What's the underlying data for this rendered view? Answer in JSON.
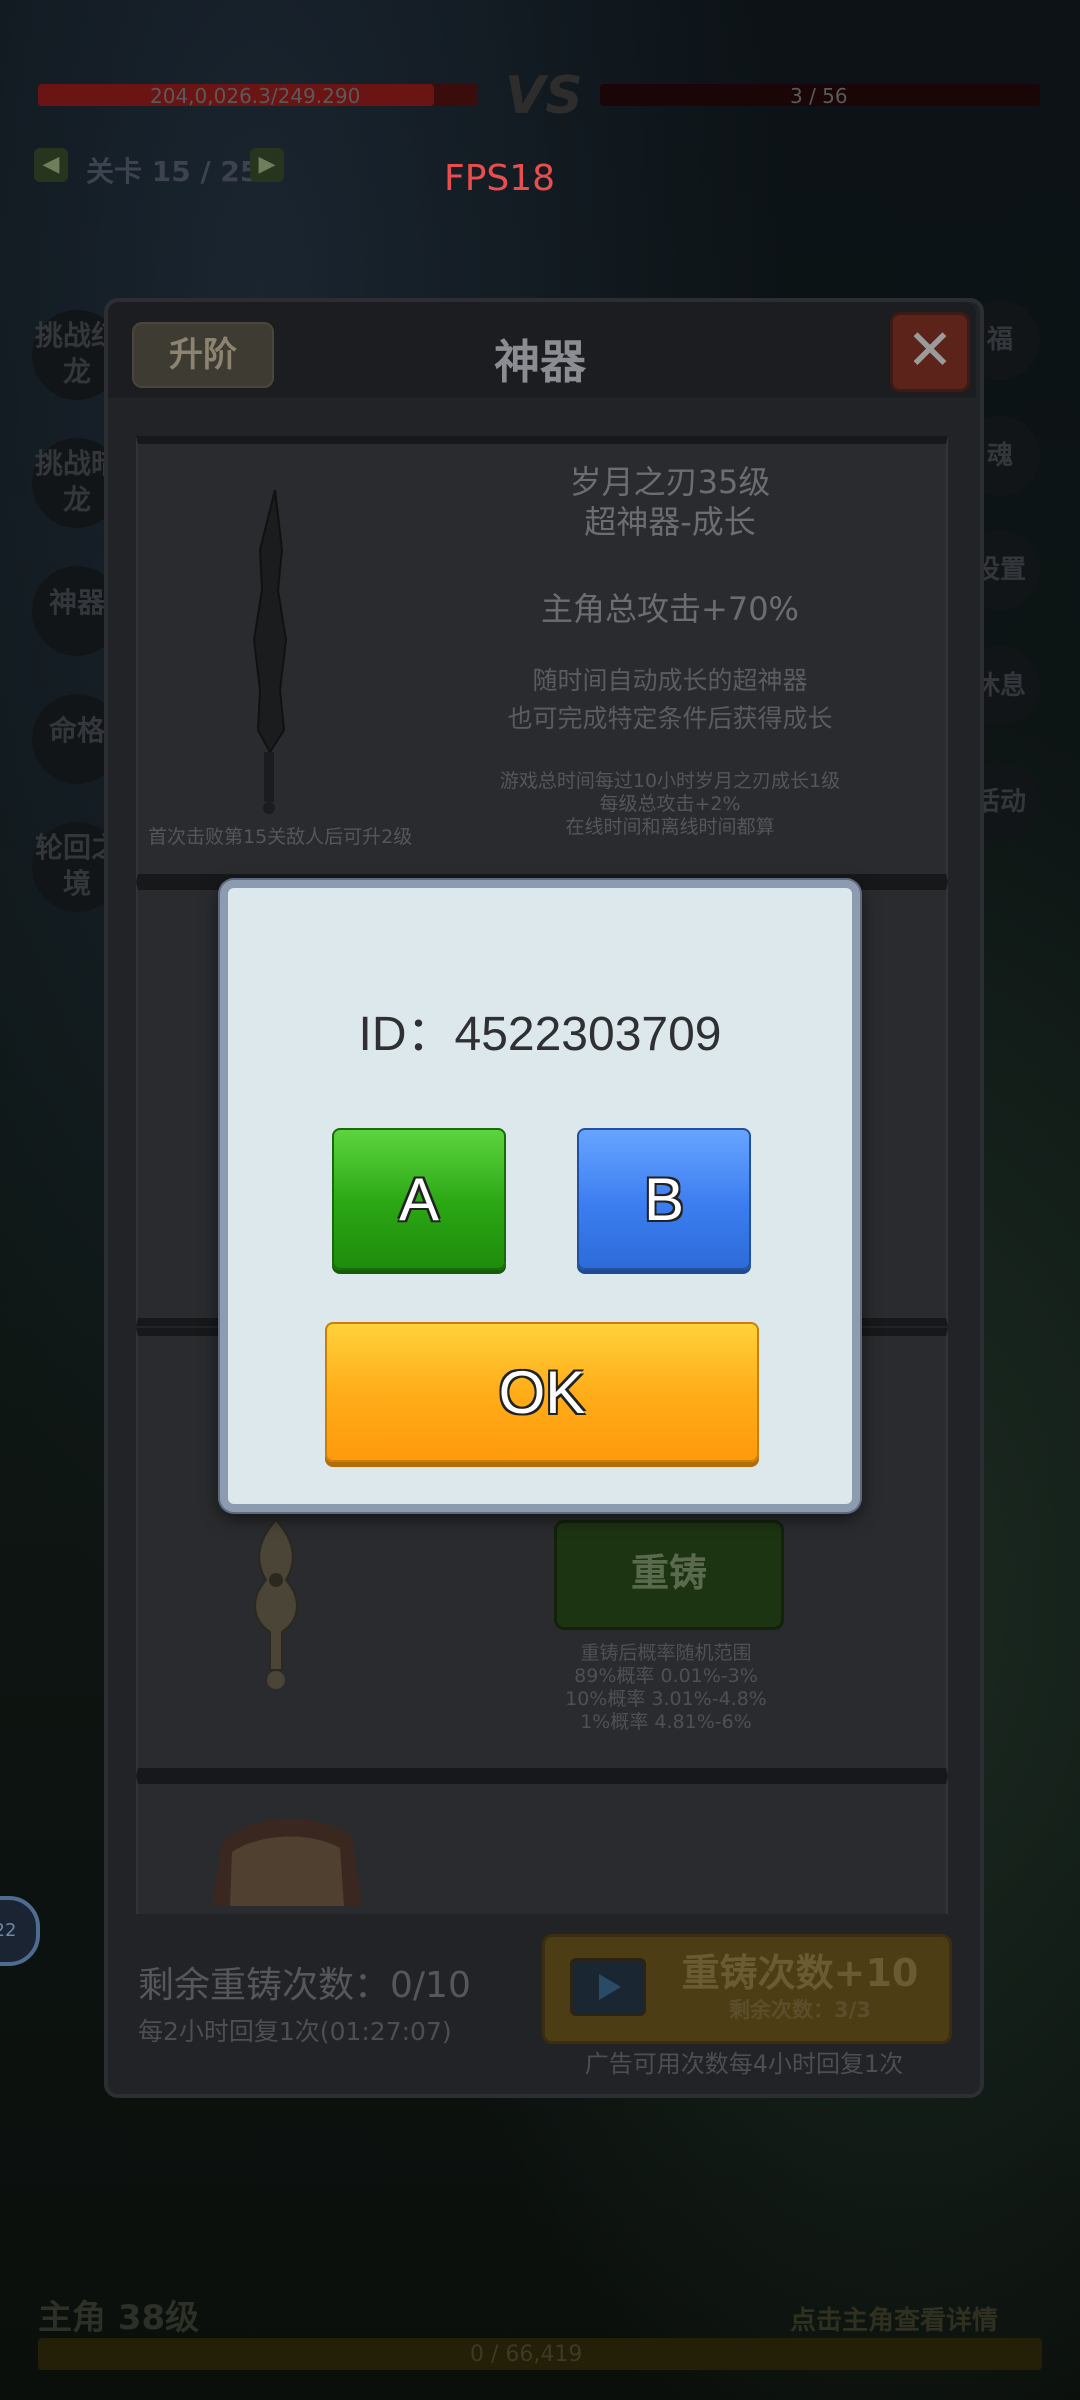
{
  "battle": {
    "hp_left": "204,0,026.3/249.290",
    "vs": "VS",
    "hp_right": "3 / 56",
    "stage": "关卡 15 / 25",
    "stage_prev": "◀",
    "stage_next": "▶",
    "fps": "FPS18"
  },
  "side_left": [
    {
      "label": "挑战红龙"
    },
    {
      "label": "挑战暗龙"
    },
    {
      "label": "神器"
    },
    {
      "label": "命格"
    },
    {
      "label": "轮回之境"
    }
  ],
  "side_right": [
    {
      "label": "福"
    },
    {
      "label": "魂"
    },
    {
      "label": "设置"
    },
    {
      "label": "休息"
    },
    {
      "label": "活动"
    }
  ],
  "panel": {
    "title": "神器",
    "upgrade_label": "升阶",
    "close_label": "✕",
    "card1": {
      "name_line1": "岁月之刃35级",
      "name_line2": "超神器-成长",
      "attack": "主角总攻击+70%",
      "desc_line1": "随时间自动成长的超神器",
      "desc_line2": "也可完成特定条件后获得成长",
      "rule_line1": "游戏总时间每过10小时岁月之刃成长1级",
      "rule_line2": "每级总攻击+2%",
      "rule_line3": "在线时间和离线时间都算",
      "note": "首次击败第15关敌人后可升2级"
    },
    "card3": {
      "reforge_label": "重铸",
      "note_line1": "重铸后概率随机范围",
      "note_line2": "89%概率 0.01%-3%",
      "note_line3": "10%概率 3.01%-4.8%",
      "note_line4": "1%概率 4.81%-6%"
    },
    "footer": {
      "remain": "剩余重铸次数：0/10",
      "recover": "每2小时回复1次(01:27:07)",
      "ad_title": "重铸次数+10",
      "ad_sub": "剩余次数：3/3",
      "ad_note": "广告可用次数每4小时回复1次"
    }
  },
  "bottom": {
    "title": "主角 38级",
    "right": "点击主角查看详情",
    "bar_text": "0 / 66,419"
  },
  "avatar_badge": "22",
  "dialog": {
    "id_text": "ID：4522303709",
    "a_label": "A",
    "b_label": "B",
    "ok_label": "OK"
  },
  "colors": {
    "a_button": "#2aa613",
    "b_button": "#3b7df0",
    "ok_button": "#ffad1a",
    "dialog_bg": "#dde8ec",
    "fps_text": "#e94e4e"
  }
}
